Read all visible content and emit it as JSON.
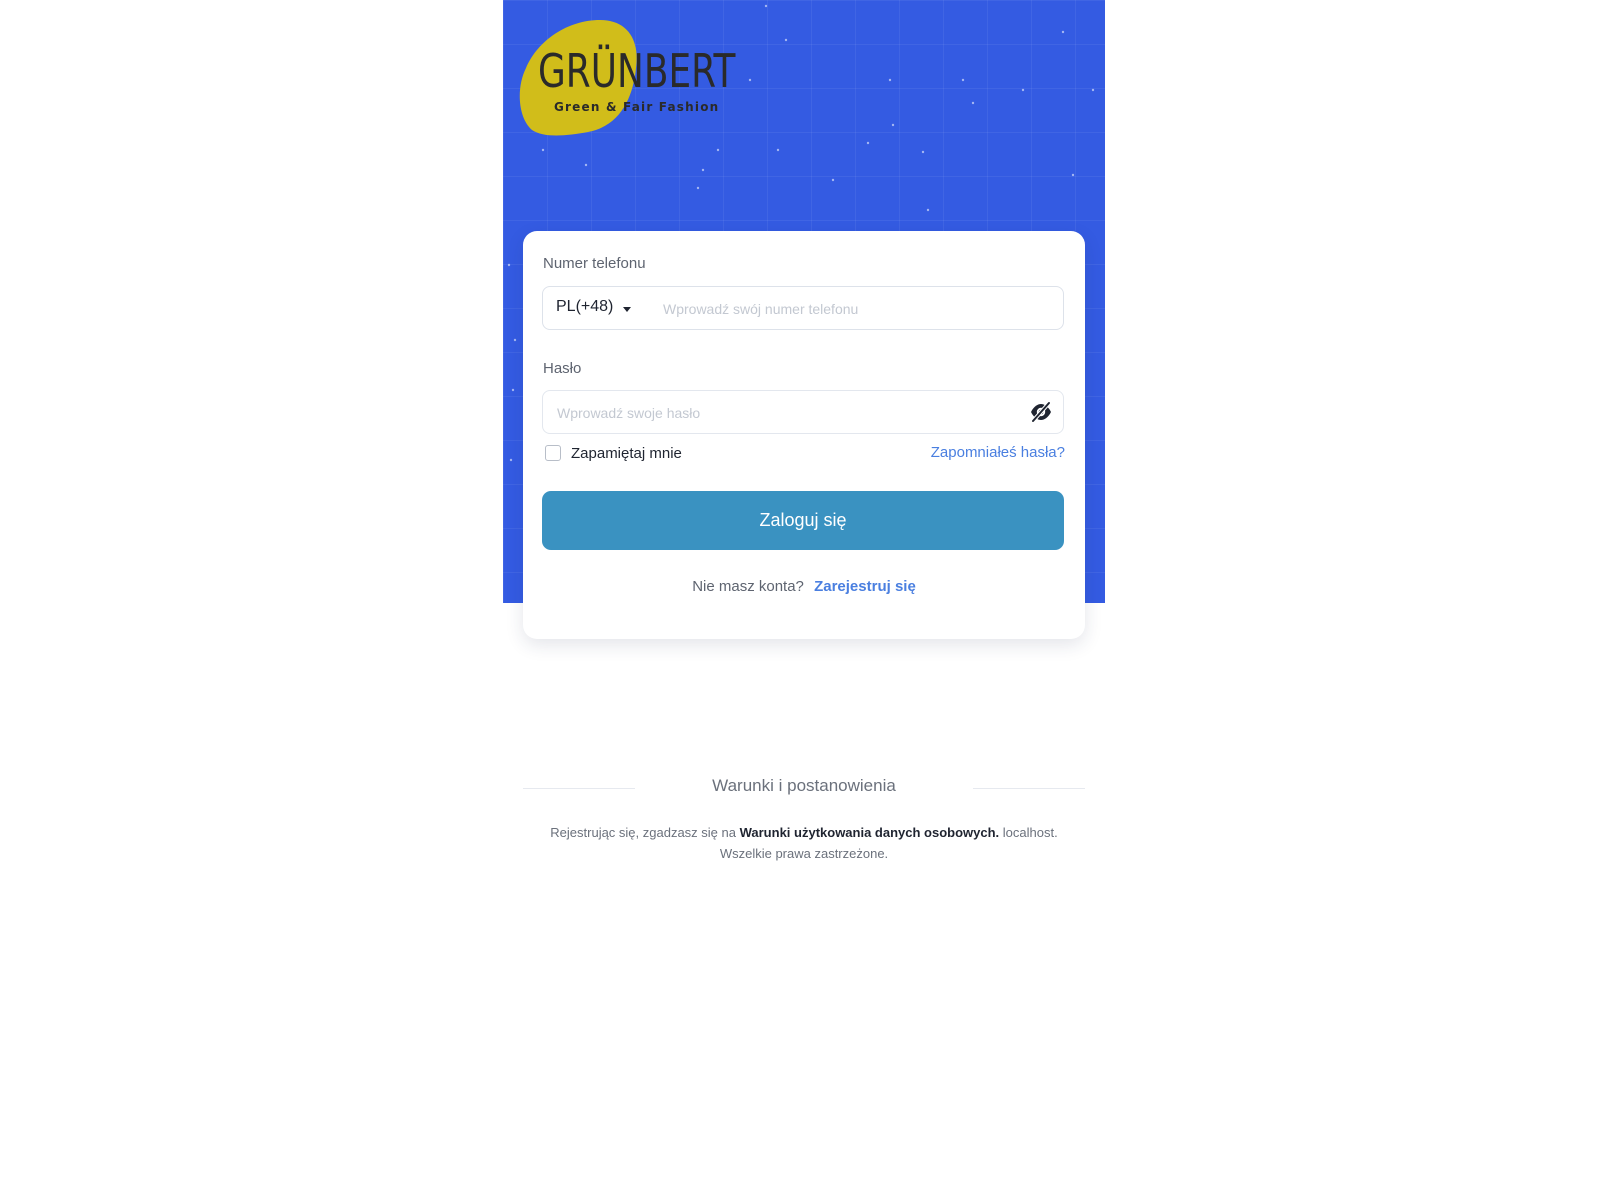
{
  "brand": {
    "name": "GRÜNBERT",
    "tagline": "Green & Fair Fashion",
    "logo_blob_color": "#d1bd1a",
    "hero_color": "#345be2"
  },
  "login_form": {
    "phone_label": "Numer telefonu",
    "country_code": "PL(+48)",
    "phone_placeholder": "Wprowadź swój numer telefonu",
    "password_label": "Hasło",
    "password_placeholder": "Wprowadź swoje hasło",
    "password_toggle_icon": "eye-off-icon",
    "remember_me_label": "Zapamiętaj mnie",
    "remember_me_checked": false,
    "forgot_password_link": "Zapomniałeś hasła?",
    "submit_label": "Zaloguj się",
    "submit_color": "#3a92c1",
    "link_color": "#4a7fe0",
    "no_account_text": "Nie masz konta?",
    "register_link": "Zarejestruj się"
  },
  "footer": {
    "terms_heading": "Warunki i postanowienia",
    "terms_prefix": "Rejestrując się, zgadzasz się na",
    "terms_link": "Warunki użytkowania danych osobowych.",
    "terms_suffix": "localhost. Wszelkie prawa zastrzeżone."
  }
}
